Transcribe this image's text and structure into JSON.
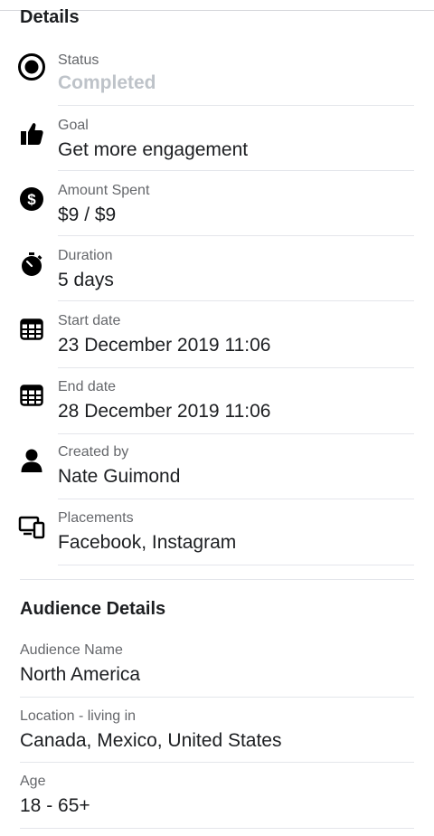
{
  "details": {
    "title": "Details",
    "rows": [
      {
        "label": "Status",
        "value": "Completed",
        "icon": "radio-selected-icon"
      },
      {
        "label": "Goal",
        "value": "Get more engagement",
        "icon": "thumbs-up-icon"
      },
      {
        "label": "Amount Spent",
        "value": "$9 / $9",
        "icon": "dollar-coin-icon"
      },
      {
        "label": "Duration",
        "value": "5 days",
        "icon": "stopwatch-icon"
      },
      {
        "label": "Start date",
        "value": "23 December 2019 11:06",
        "icon": "calendar-icon"
      },
      {
        "label": "End date",
        "value": "28 December 2019 11:06",
        "icon": "calendar-icon"
      },
      {
        "label": "Created by",
        "value": "Nate Guimond",
        "icon": "person-icon"
      },
      {
        "label": "Placements",
        "value": "Facebook, Instagram",
        "icon": "devices-icon"
      }
    ]
  },
  "audience": {
    "title": "Audience Details",
    "rows": [
      {
        "label": "Audience Name",
        "value": "North America"
      },
      {
        "label": "Location - living in",
        "value": "Canada, Mexico, United States"
      },
      {
        "label": "Age",
        "value": "18 - 65+"
      }
    ]
  }
}
